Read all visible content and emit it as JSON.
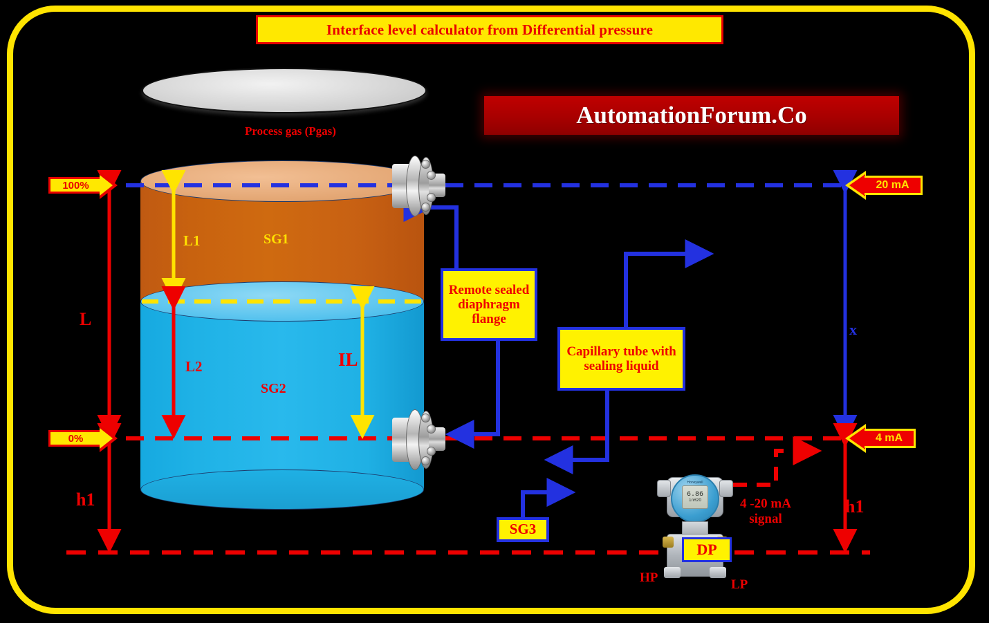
{
  "title": {
    "banner_text": "Interface level calculator from Differential pressure"
  },
  "logo": {
    "text": "AutomationForum.Co"
  },
  "tank": {
    "gas_label": "Process gas (Pgas)",
    "upper_liquid_length_label": "L1",
    "upper_liquid_sg_label": "SG1",
    "lower_liquid_length_label": "L2",
    "lower_liquid_sg_label": "SG2",
    "interface_level_label": "IL"
  },
  "range_markers": {
    "span_high_percent": "100%",
    "span_low_percent": "0%",
    "current_high": "20 mA",
    "current_low": "4 mA"
  },
  "dimensions": {
    "total_level": "L",
    "left_offset": "h1",
    "right_offset": "h1",
    "capillary_height": "x"
  },
  "callouts": {
    "remote_seal": "Remote sealed diaphragm flange",
    "capillary": "Capillary tube with sealing liquid",
    "fill_fluid_sg": "SG3"
  },
  "transmitter": {
    "badge": "DP",
    "brand": "Honeywell",
    "display_value": "6.86",
    "display_unit": "inH2O",
    "high_port": "HP",
    "low_port": "LP",
    "signal_label": "4 -20 mA signal"
  },
  "colors": {
    "frame": "#ffe400",
    "background": "#000000",
    "banner_fill": "#ffe800",
    "banner_border": "#e80000",
    "text_red": "#ee0000",
    "text_yellow": "#ffe000",
    "blue_line": "#2331e0",
    "logo_red": "#c00000",
    "upper_liquid": "#c8620f",
    "lower_liquid": "#29b9ec",
    "callout_fill": "#fff200",
    "callout_border": "#2331e0"
  }
}
